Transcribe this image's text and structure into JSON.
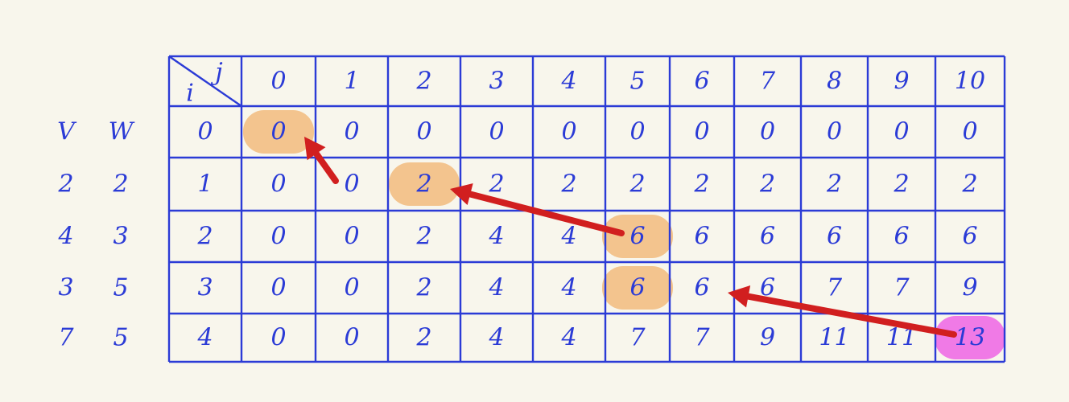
{
  "corner": {
    "i": "i",
    "j": "j"
  },
  "side_headers": {
    "v": "V",
    "w": "W"
  },
  "column_headers": [
    "0",
    "1",
    "2",
    "3",
    "4",
    "5",
    "6",
    "7",
    "8",
    "9",
    "10"
  ],
  "rows": [
    {
      "v": "",
      "w": "",
      "i": "0",
      "cells": [
        "0",
        "0",
        "0",
        "0",
        "0",
        "0",
        "0",
        "0",
        "0",
        "0",
        "0"
      ]
    },
    {
      "v": "2",
      "w": "2",
      "i": "1",
      "cells": [
        "0",
        "0",
        "2",
        "2",
        "2",
        "2",
        "2",
        "2",
        "2",
        "2",
        "2"
      ]
    },
    {
      "v": "4",
      "w": "3",
      "i": "2",
      "cells": [
        "0",
        "0",
        "2",
        "4",
        "4",
        "6",
        "6",
        "6",
        "6",
        "6",
        "6"
      ]
    },
    {
      "v": "3",
      "w": "5",
      "i": "3",
      "cells": [
        "0",
        "0",
        "2",
        "4",
        "4",
        "6",
        "6",
        "6",
        "7",
        "7",
        "9"
      ]
    },
    {
      "v": "7",
      "w": "5",
      "i": "4",
      "cells": [
        "0",
        "0",
        "2",
        "4",
        "4",
        "7",
        "7",
        "9",
        "11",
        "11",
        "13"
      ]
    }
  ],
  "colors": {
    "ink": "#2b3bd6",
    "highlight_path": "#f3c48e",
    "highlight_answer": "#f07ae6",
    "arrow": "#d11f1f",
    "background": "#f8f6ec"
  },
  "highlights": [
    {
      "row": 0,
      "col": 0,
      "kind": "path"
    },
    {
      "row": 1,
      "col": 2,
      "kind": "path"
    },
    {
      "row": 2,
      "col": 5,
      "kind": "path"
    },
    {
      "row": 3,
      "col": 5,
      "kind": "path"
    },
    {
      "row": 4,
      "col": 10,
      "kind": "answer"
    }
  ],
  "arrows": [
    {
      "from": [
        4,
        10
      ],
      "to": [
        3,
        6
      ]
    },
    {
      "from": [
        2,
        5
      ],
      "to": [
        1,
        2
      ]
    },
    {
      "from": [
        1,
        1
      ],
      "to": [
        0,
        0
      ]
    }
  ]
}
